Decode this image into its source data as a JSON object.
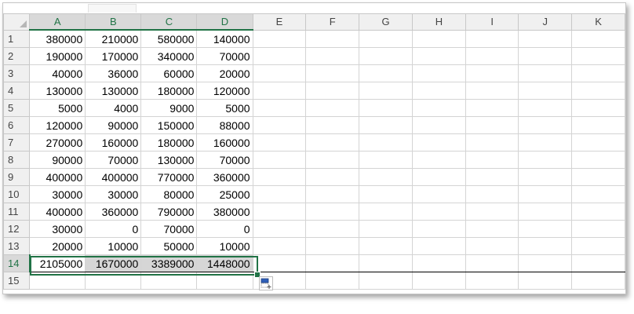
{
  "columns": [
    "A",
    "B",
    "C",
    "D",
    "E",
    "F",
    "G",
    "H",
    "I",
    "J",
    "K"
  ],
  "rows": [
    {
      "num": "1",
      "cells": [
        "380000",
        "210000",
        "580000",
        "140000"
      ]
    },
    {
      "num": "2",
      "cells": [
        "190000",
        "170000",
        "340000",
        "70000"
      ]
    },
    {
      "num": "3",
      "cells": [
        "40000",
        "36000",
        "60000",
        "20000"
      ]
    },
    {
      "num": "4",
      "cells": [
        "130000",
        "130000",
        "180000",
        "120000"
      ]
    },
    {
      "num": "5",
      "cells": [
        "5000",
        "4000",
        "9000",
        "5000"
      ]
    },
    {
      "num": "6",
      "cells": [
        "120000",
        "90000",
        "150000",
        "88000"
      ]
    },
    {
      "num": "7",
      "cells": [
        "270000",
        "160000",
        "180000",
        "160000"
      ]
    },
    {
      "num": "8",
      "cells": [
        "90000",
        "70000",
        "130000",
        "70000"
      ]
    },
    {
      "num": "9",
      "cells": [
        "400000",
        "400000",
        "770000",
        "360000"
      ]
    },
    {
      "num": "10",
      "cells": [
        "30000",
        "30000",
        "80000",
        "25000"
      ]
    },
    {
      "num": "11",
      "cells": [
        "400000",
        "360000",
        "790000",
        "380000"
      ]
    },
    {
      "num": "12",
      "cells": [
        "30000",
        "0",
        "70000",
        "0"
      ]
    },
    {
      "num": "13",
      "cells": [
        "20000",
        "10000",
        "50000",
        "10000"
      ]
    },
    {
      "num": "14",
      "cells": [
        "2105000",
        "1670000",
        "3389000",
        "1448000"
      ]
    },
    {
      "num": "15",
      "cells": [
        "",
        "",
        "",
        ""
      ]
    }
  ],
  "selection": {
    "range": "A14:D14",
    "active_cell": "A14",
    "accent_color": "#217346"
  },
  "icons": {
    "quick_analysis": "quick-analysis-icon",
    "corner": "select-all-corner-icon"
  }
}
